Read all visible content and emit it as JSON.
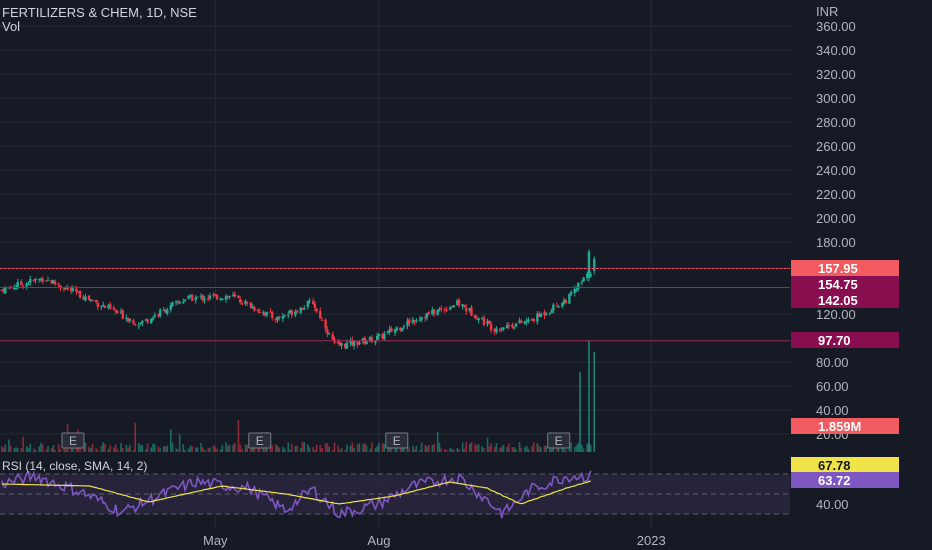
{
  "header": {
    "title": "FERTILIZERS & CHEM, 1D, NSE",
    "volume_label": "Vol",
    "currency": "INR"
  },
  "colors": {
    "background": "#161a25",
    "grid": "#262a35",
    "up": "#22ab94",
    "down": "#f23645",
    "level_line": "#9c2a4f",
    "badge_last": "#f15a5e",
    "badge_level": "#880e4f",
    "rsi_line": "#7e57c2",
    "rsi_sma": "#f0e44a",
    "rsi_band": "#2a2640"
  },
  "chart_data": [
    {
      "type": "candlestick",
      "name": "price",
      "x_axis": {
        "ticks": [
          "May",
          "Aug",
          "2023"
        ]
      },
      "y_axis": {
        "range": [
          0,
          370
        ],
        "ticks": [
          360,
          340,
          320,
          300,
          280,
          260,
          240,
          220,
          200,
          180,
          120,
          80,
          60,
          40,
          20
        ]
      },
      "y_tick_labels": [
        "360.00",
        "340.00",
        "320.00",
        "300.00",
        "280.00",
        "260.00",
        "240.00",
        "220.00",
        "200.00",
        "180.00",
        "120.00",
        "80.00",
        "60.00",
        "40.00",
        "20.00"
      ],
      "horizontal_levels": [
        158,
        142.05,
        97.7
      ],
      "price_badges": [
        {
          "label": "157.95",
          "value": 157.95,
          "kind": "last"
        },
        {
          "label": "154.75",
          "value": 154.75,
          "kind": "level"
        },
        {
          "label": "142.05",
          "value": 142.05,
          "kind": "level"
        },
        {
          "label": "97.70",
          "value": 97.7,
          "kind": "level"
        },
        {
          "label": "1.859M",
          "value": 12,
          "kind": "last"
        }
      ],
      "earnings_markers": {
        "label": "E",
        "dates": [
          "2022-02-10",
          "2022-05-26",
          "2022-08-11",
          "2022-11-10"
        ]
      },
      "series": [
        {
          "date": "2022-01-01",
          "close": 140
        },
        {
          "date": "2022-01-25",
          "close": 150
        },
        {
          "date": "2022-02-20",
          "close": 132
        },
        {
          "date": "2022-03-20",
          "close": 112
        },
        {
          "date": "2022-04-15",
          "close": 133
        },
        {
          "date": "2022-05-10",
          "close": 135
        },
        {
          "date": "2022-06-05",
          "close": 116
        },
        {
          "date": "2022-06-25",
          "close": 130
        },
        {
          "date": "2022-07-08",
          "close": 93
        },
        {
          "date": "2022-08-01",
          "close": 100
        },
        {
          "date": "2022-08-20",
          "close": 115
        },
        {
          "date": "2022-09-15",
          "close": 129
        },
        {
          "date": "2022-10-05",
          "close": 108
        },
        {
          "date": "2022-10-25",
          "close": 114
        },
        {
          "date": "2022-11-15",
          "close": 132
        },
        {
          "date": "2022-11-30",
          "close": 158
        }
      ]
    },
    {
      "type": "line",
      "name": "RSI (14, close, SMA, 14, 2)",
      "y_axis": {
        "range": [
          20,
          80
        ],
        "ticks": [
          40
        ],
        "band": [
          30,
          70
        ]
      },
      "y_tick_labels": [
        "40.00"
      ],
      "value_badges": [
        {
          "label": "67.78",
          "value": 67.78,
          "series": "sma"
        },
        {
          "label": "63.72",
          "value": 63.72,
          "series": "rsi"
        }
      ],
      "rsi_points": [
        {
          "date": "2022-01-01",
          "value": 60
        },
        {
          "date": "2022-01-20",
          "value": 68
        },
        {
          "date": "2022-02-15",
          "value": 52
        },
        {
          "date": "2022-03-10",
          "value": 32
        },
        {
          "date": "2022-03-25",
          "value": 44
        },
        {
          "date": "2022-04-20",
          "value": 62
        },
        {
          "date": "2022-05-20",
          "value": 56
        },
        {
          "date": "2022-06-10",
          "value": 34
        },
        {
          "date": "2022-06-25",
          "value": 55
        },
        {
          "date": "2022-07-10",
          "value": 30
        },
        {
          "date": "2022-08-01",
          "value": 40
        },
        {
          "date": "2022-08-20",
          "value": 58
        },
        {
          "date": "2022-09-15",
          "value": 67
        },
        {
          "date": "2022-10-01",
          "value": 44
        },
        {
          "date": "2022-10-10",
          "value": 30
        },
        {
          "date": "2022-10-25",
          "value": 54
        },
        {
          "date": "2022-11-15",
          "value": 68
        },
        {
          "date": "2022-11-30",
          "value": 67.78
        }
      ],
      "sma_points": [
        {
          "date": "2022-01-01",
          "value": 60
        },
        {
          "date": "2022-02-20",
          "value": 58
        },
        {
          "date": "2022-03-25",
          "value": 42
        },
        {
          "date": "2022-05-05",
          "value": 58
        },
        {
          "date": "2022-06-10",
          "value": 50
        },
        {
          "date": "2022-07-10",
          "value": 40
        },
        {
          "date": "2022-08-10",
          "value": 48
        },
        {
          "date": "2022-09-10",
          "value": 62
        },
        {
          "date": "2022-10-01",
          "value": 56
        },
        {
          "date": "2022-10-20",
          "value": 40
        },
        {
          "date": "2022-11-15",
          "value": 56
        },
        {
          "date": "2022-11-30",
          "value": 63.72
        }
      ]
    }
  ]
}
